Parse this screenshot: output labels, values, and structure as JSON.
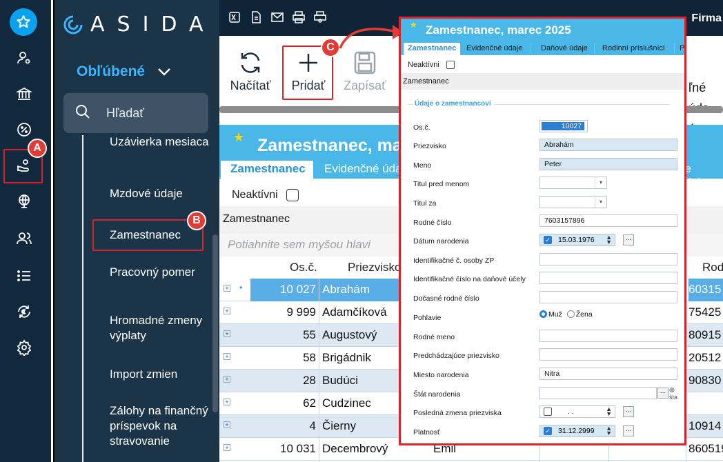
{
  "rail": {
    "items": [
      "favorites-star-icon",
      "user-settings-icon",
      "bank-icon",
      "percent-icon",
      "hand-coins-icon",
      "globe-icon",
      "users-icon",
      "list-icon",
      "euro-cycle-icon",
      "gear-icon"
    ]
  },
  "brand": {
    "name": "ASIDA"
  },
  "nav": {
    "favorites_label": "Obľúbené",
    "search_placeholder": "Hľadať",
    "items": [
      "Uzávierka mesiaca",
      "Mzdové údaje",
      "Zamestnanec",
      "Pracovný pomer",
      "Hromadné zmeny výplaty",
      "Import zmien",
      "Zálohy na finančný príspevok na stravovanie"
    ]
  },
  "topbar": {
    "firma": "Firma"
  },
  "toolbar": {
    "refresh": "Načítať",
    "add": "Pridať",
    "save": "Zapísať"
  },
  "background": {
    "title": "Zamestnanec, ma",
    "tab_active": "Zamestnanec",
    "tab2": "Evidenčné úda",
    "tab_right": "ne údaje",
    "inactive_label": "Neaktívni",
    "group_header": "Zamestnanec",
    "drag_hint": "Potiahnite sem myšou hlavi",
    "col_num": "Os.č.",
    "col_surname": "Priezvisko",
    "col_rc": "Rod",
    "right_partial": [
      "ľné úda",
      "á",
      "ty"
    ],
    "rows": [
      {
        "num": "10 027",
        "surname": "Abrahám",
        "first": "",
        "rc": "60315"
      },
      {
        "num": "9 999",
        "surname": "Adamčíková",
        "first": "",
        "rc": "75425"
      },
      {
        "num": "55",
        "surname": "Augustový",
        "first": "",
        "rc": "80915"
      },
      {
        "num": "58",
        "surname": "Brigádnik",
        "first": "",
        "rc": "20512"
      },
      {
        "num": "28",
        "surname": "Budúci",
        "first": "",
        "rc": "90830"
      },
      {
        "num": "62",
        "surname": "Cudzinec",
        "first": "",
        "rc": ""
      },
      {
        "num": "4",
        "surname": "Čierny",
        "first": "",
        "rc": "10914"
      },
      {
        "num": "10 031",
        "surname": "Decembrový",
        "first": "Emil",
        "rc": "860519"
      }
    ]
  },
  "annotations": {
    "a": "A",
    "b": "B",
    "c": "C"
  },
  "dialog": {
    "title": "Zamestnanec, marec 2025",
    "tabs": [
      "Zamestnanec",
      "Evidenčné údaje",
      "Daňové údaje",
      "Rodinní príslušníci",
      "P"
    ],
    "inactive_label": "Neaktívni",
    "group_header": "Zamestnanec",
    "section": "Údaje o zamestnancovi",
    "fields": {
      "osc_label": "Os.č.",
      "osc_value": "10027",
      "surname_label": "Priezvisko",
      "surname_value": "Abrahám",
      "name_label": "Meno",
      "name_value": "Peter",
      "title_before_label": "Titul pred menom",
      "title_after_label": "Titul za",
      "rc_label": "Rodné číslo",
      "rc_value": "7603157896",
      "birth_label": "Dátum narodenia",
      "birth_value": "15.03.1976",
      "zp_label": "Identifikačné č. osoby ZP",
      "tax_label": "Identifikačné číslo na daňové účely",
      "temp_rc_label": "Dočasné rodné číslo",
      "gender_label": "Pohlavie",
      "gender_male": "Muž",
      "gender_female": "Žena",
      "birth_name_label": "Rodné meno",
      "prev_surname_label": "Predchádzajúce priezvisko",
      "birth_place_label": "Miesto narodenia",
      "birth_place_value": "Nitra",
      "birth_state_label": "Štát narodenia",
      "birth_state_suffix": "šta",
      "last_change_label": "Posledná zmena priezviska",
      "last_change_value": ".   .",
      "validity_label": "Platnosť",
      "validity_value": "31.12.2999"
    }
  }
}
